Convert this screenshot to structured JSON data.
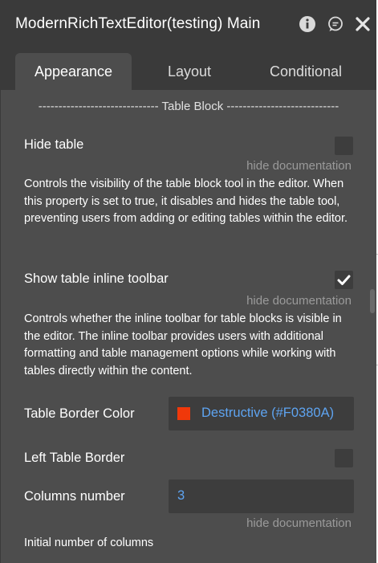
{
  "window": {
    "title": "ModernRichTextEditor(testing) Main",
    "icons": [
      "info-icon",
      "comment-icon",
      "close-icon"
    ]
  },
  "tabs": [
    {
      "label": "Appearance",
      "active": true
    },
    {
      "label": "Layout",
      "active": false
    },
    {
      "label": "Conditional",
      "active": false
    }
  ],
  "section": {
    "header": "------------------------------ Table Block ----------------------------"
  },
  "fields": {
    "hide_table": {
      "label": "Hide table",
      "checked": false,
      "hide_doc": "hide documentation",
      "description": "Controls the visibility of the table block tool in the editor. When this property is set to true, it disables and hides the table tool, preventing users from adding or editing tables within the editor."
    },
    "show_inline_toolbar": {
      "label": "Show table inline toolbar",
      "checked": true,
      "hide_doc": "hide documentation",
      "description": "Controls whether the inline toolbar for table blocks is visible in the editor. The inline toolbar provides users with additional formatting and table management options while working with tables directly within the content."
    },
    "border_color": {
      "label": "Table Border Color",
      "value": "Destructive (#F0380A)",
      "swatch": "#F0380A"
    },
    "left_border": {
      "label": "Left Table Border",
      "checked": false
    },
    "columns": {
      "label": "Columns number",
      "value": "3",
      "hide_doc": "hide documentation",
      "description": "Initial number of columns"
    }
  },
  "colors": {
    "panel_bg": "#4d4d4d",
    "header_bg": "#3a3a3a",
    "input_bg": "#3d3d3d",
    "link_blue": "#5ea4f1",
    "muted_text": "#9a9a9a"
  }
}
